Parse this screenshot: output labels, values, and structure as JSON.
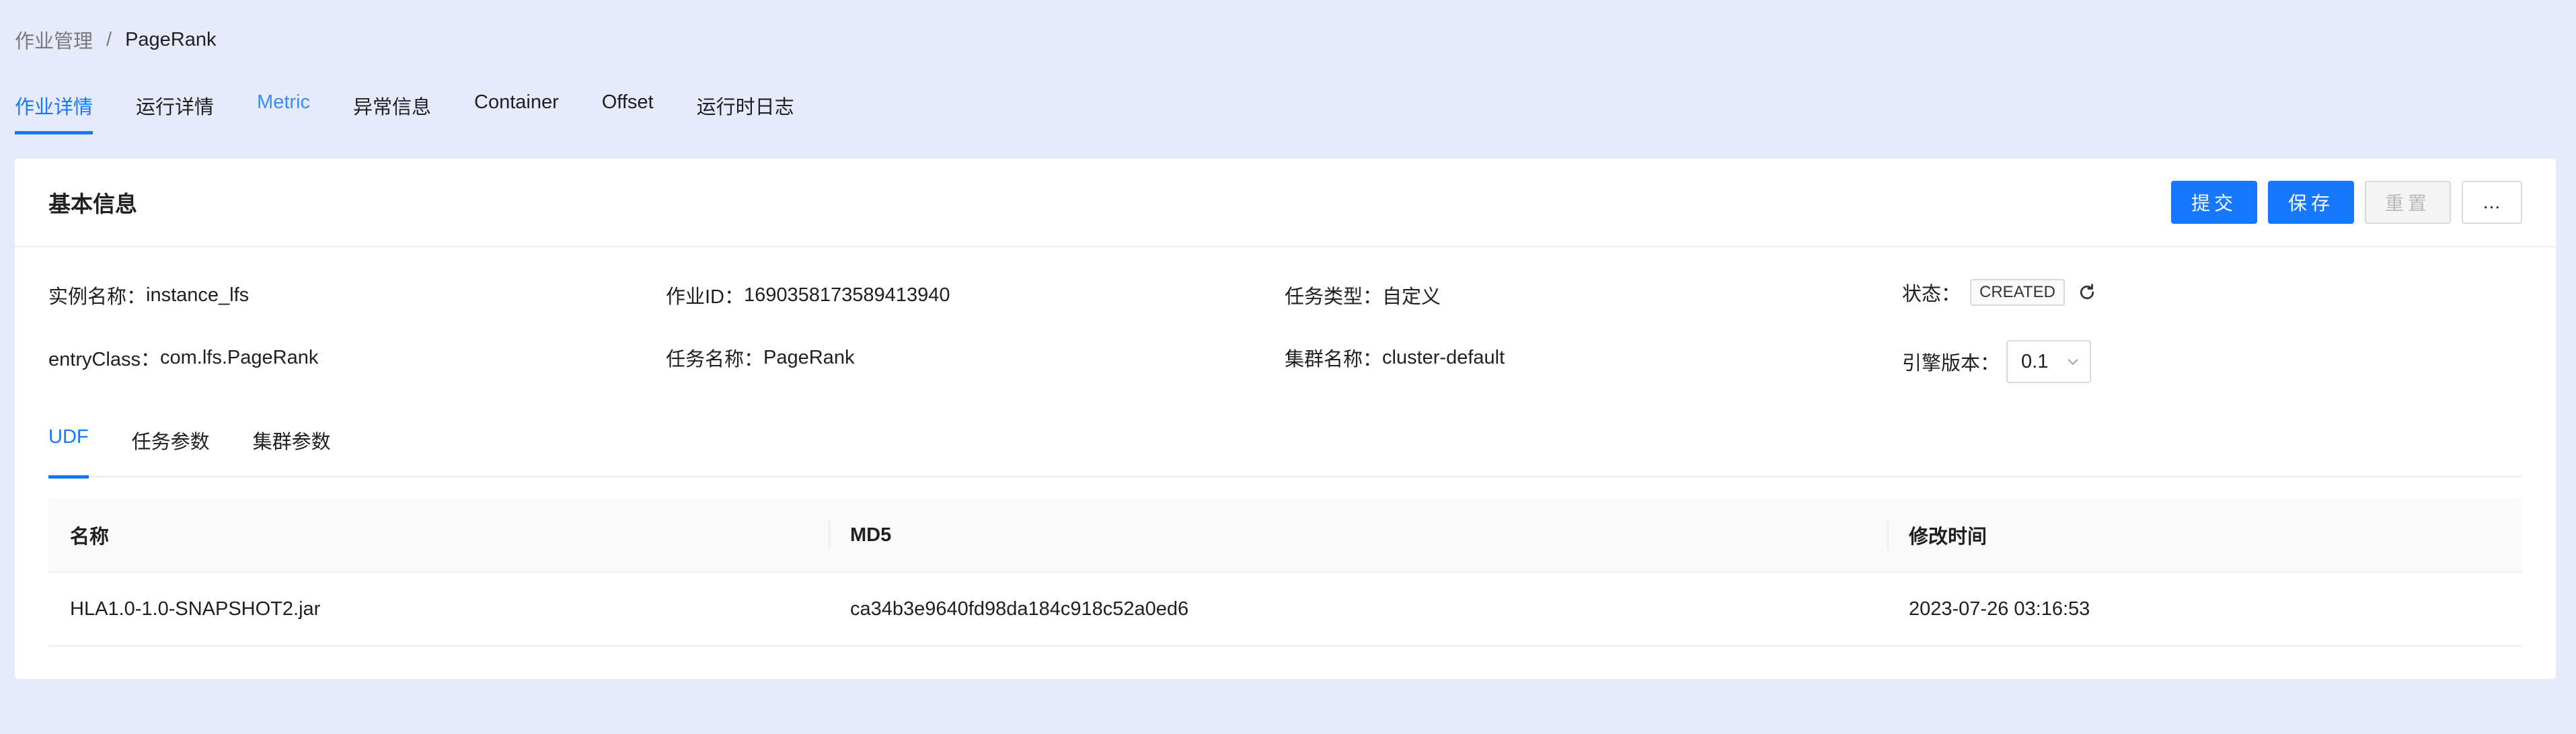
{
  "breadcrumb": {
    "parent": "作业管理",
    "separator": "/",
    "current": "PageRank"
  },
  "tabs": [
    {
      "label": "作业详情"
    },
    {
      "label": "运行详情"
    },
    {
      "label": "Metric"
    },
    {
      "label": "异常信息"
    },
    {
      "label": "Container"
    },
    {
      "label": "Offset"
    },
    {
      "label": "运行时日志"
    }
  ],
  "card": {
    "title": "基本信息",
    "buttons": {
      "submit": "提交",
      "save": "保存",
      "reset": "重置",
      "more": "..."
    }
  },
  "info": {
    "instance_label": "实例名称：",
    "instance_value": "instance_lfs",
    "job_id_label": "作业ID：",
    "job_id_value": "1690358173589413940",
    "task_type_label": "任务类型：",
    "task_type_value": "自定义",
    "status_label": "状态：",
    "status_value": "CREATED",
    "entry_label": "entryClass：",
    "entry_value": "com.lfs.PageRank",
    "task_name_label": "任务名称：",
    "task_name_value": "PageRank",
    "cluster_label": "集群名称：",
    "cluster_value": "cluster-default",
    "engine_label": "引擎版本：",
    "engine_value": "0.1"
  },
  "subtabs": [
    {
      "label": "UDF"
    },
    {
      "label": "任务参数"
    },
    {
      "label": "集群参数"
    }
  ],
  "table": {
    "columns": [
      "名称",
      "MD5",
      "修改时间"
    ],
    "rows": [
      [
        "HLA1.0-1.0-SNAPSHOT2.jar",
        "ca34b3e9640fd98da184c918c52a0ed6",
        "2023-07-26 03:16:53"
      ]
    ]
  },
  "colors": {
    "accent": "#1677ff",
    "background": "#e6eafb"
  }
}
